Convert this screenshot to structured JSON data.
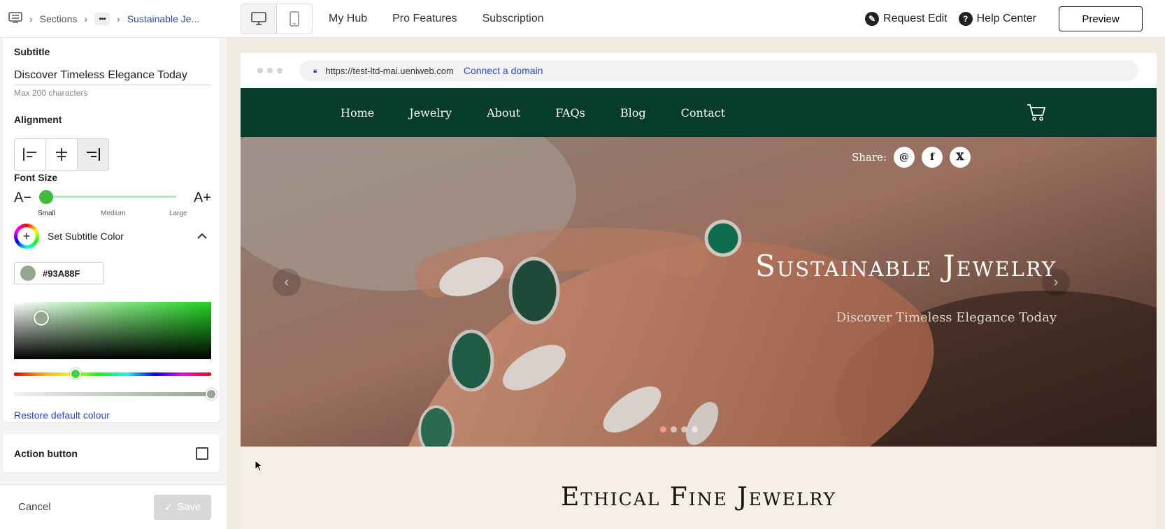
{
  "topbar": {
    "breadcrumb": [
      "Sections",
      "Sustainable Je..."
    ],
    "nav": [
      "My Hub",
      "Pro Features",
      "Subscription"
    ],
    "request_edit": "Request Edit",
    "help_center": "Help Center",
    "preview": "Preview"
  },
  "panel": {
    "subtitle_label": "Subtitle",
    "subtitle_value": "Discover Timeless Elegance Today",
    "subtitle_hint": "Max 200 characters",
    "alignment_label": "Alignment",
    "font_size_label": "Font Size",
    "font_size_decrease": "A−",
    "font_size_increase": "A+",
    "font_size_ticks": [
      "Small",
      "Medium",
      "Large"
    ],
    "color_label": "Set Subtitle Color",
    "hex_value": "#93A88F",
    "restore": "Restore default colour",
    "action_button_label": "Action button",
    "cancel": "Cancel",
    "save": "Save"
  },
  "browser": {
    "url": "https://test-ltd-mai.ueniweb.com",
    "connect": "Connect a domain"
  },
  "site": {
    "nav": [
      "Home",
      "Jewelry",
      "About",
      "FAQs",
      "Blog",
      "Contact"
    ],
    "share_label": "Share:",
    "hero_title": "Sustainable Jewelry",
    "hero_subtitle": "Discover Timeless Elegance Today",
    "section_title": "Ethical Fine Jewelry"
  },
  "colors": {
    "accent": "#2e47c9",
    "nav_bg": "#073b2c",
    "subtitle_color": "#93A88F",
    "slider_green": "#3bbd3b"
  }
}
